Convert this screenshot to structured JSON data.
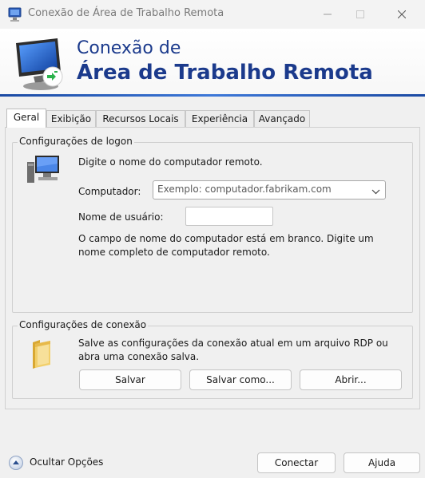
{
  "window": {
    "title": "Conexão de Área de Trabalho Remota"
  },
  "banner": {
    "line1": "Conexão de",
    "line2": "Área de Trabalho Remota"
  },
  "tabs": [
    {
      "label": "Geral",
      "active": true
    },
    {
      "label": "Exibição",
      "active": false
    },
    {
      "label": "Recursos Locais",
      "active": false
    },
    {
      "label": "Experiência",
      "active": false
    },
    {
      "label": "Avançado",
      "active": false
    }
  ],
  "logon": {
    "title": "Configurações de logon",
    "instruction": "Digite o nome do computador remoto.",
    "computer_label": "Computador:",
    "computer_placeholder": "Exemplo: computador.fabrikam.com",
    "username_label": "Nome de usuário:",
    "username_value": "",
    "warning_line1": "O campo de nome do computador está em branco. Digite um",
    "warning_line2": "nome completo de computador remoto."
  },
  "connection": {
    "title": "Configurações de conexão",
    "desc_line1": "Salve as configurações da conexão atual em um arquivo RDP ou",
    "desc_line2": "abra uma conexão salva.",
    "save_label": "Salvar",
    "save_as_label": "Salvar como...",
    "open_label": "Abrir..."
  },
  "footer": {
    "toggle_label": "Ocultar Opções",
    "connect_label": "Conectar",
    "help_label": "Ajuda"
  },
  "colors": {
    "banner_text": "#1b3a8c",
    "banner_stripe": "#3d78d8"
  }
}
